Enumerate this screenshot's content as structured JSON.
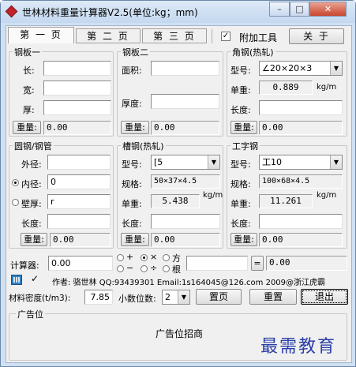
{
  "window": {
    "title": "世林材料重量计算器V2.5(单位:kg；mm)",
    "minimize": "–",
    "maximize": "□",
    "close": "✕"
  },
  "tabs": [
    {
      "label": "第 一 页",
      "active": true
    },
    {
      "label": "第 二 页",
      "active": false
    },
    {
      "label": "第 三 页",
      "active": false
    }
  ],
  "extra_tools": {
    "label": "附加工具",
    "checked": true
  },
  "about_button": "关 于",
  "steel_plate_1": {
    "title": "钢板一",
    "length_label": "长:",
    "length_value": "",
    "width_label": "宽:",
    "width_value": "",
    "thick_label": "厚:",
    "thick_value": "",
    "weight_button": "重量:",
    "weight_value": "0.00"
  },
  "steel_plate_2": {
    "title": "钢板二",
    "area_label": "面积:",
    "area_value": "",
    "thick_label": "厚度:",
    "thick_value": "",
    "weight_button": "重量:",
    "weight_value": "0.00"
  },
  "angle_steel": {
    "title": "角钢(热轧)",
    "model_label": "型号:",
    "model_value": "∠20×20×3",
    "unit_weight_label": "单重:",
    "unit_weight_value": "0.889",
    "unit": "kg/m",
    "length_label": "长度:",
    "length_value": "",
    "weight_button": "重量:",
    "weight_value": "0.00"
  },
  "round_pipe": {
    "title": "圆钢/钢管",
    "outer_label": "外径:",
    "outer_value": "",
    "inner_label": "内径:",
    "inner_value": "0",
    "wall_label": "壁厚:",
    "wall_value": "r",
    "length_label": "长度:",
    "length_value": "",
    "weight_button": "重量:",
    "weight_value": "0.00"
  },
  "channel_steel": {
    "title": "槽钢(热轧)",
    "model_label": "型号:",
    "model_value": "[5",
    "spec_label": "规格:",
    "spec_value": "50×37×4.5",
    "unit_weight_label": "单重:",
    "unit_weight_value": "5.438",
    "unit": "kg/m",
    "length_label": "长度:",
    "length_value": "",
    "weight_button": "重量:",
    "weight_value": "0.00"
  },
  "i_beam": {
    "title": "工字钢",
    "model_label": "型号:",
    "model_value": "工10",
    "spec_label": "规格:",
    "spec_value": "100×68×4.5",
    "unit_weight_label": "单重:",
    "unit_weight_value": "11.261",
    "unit": "kg/m",
    "length_label": "长度:",
    "length_value": "",
    "weight_button": "重量:",
    "weight_value": "0.00"
  },
  "calculator": {
    "label": "计算器:",
    "operand1": "0.00",
    "ops": [
      "+",
      "×",
      "方",
      "−",
      "÷",
      "根"
    ],
    "selected_op": "×",
    "operand2": "",
    "equals": "=",
    "result": "0.00"
  },
  "author_line": "作者: 骆世林 QQ:93439301 Email:1s164045@126.com  2009@浙江虎霸",
  "density": {
    "label": "材料密度(t/m3):",
    "value": "7.85"
  },
  "decimals": {
    "label": "小数位数:",
    "value": "2"
  },
  "buttons": {
    "reset_page": "置页",
    "reset": "重置",
    "exit": "退出"
  },
  "ad": {
    "title": "广告位",
    "text": "广告位招商"
  },
  "watermark": "最需教育",
  "colors": {
    "accent": "#2f5597",
    "watermark": "#2c3fa8"
  }
}
